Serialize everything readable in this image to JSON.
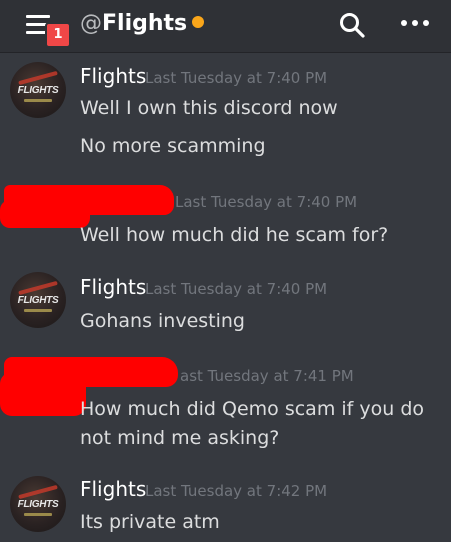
{
  "header": {
    "badge_count": "1",
    "at": "@",
    "channel_name": "Flights",
    "status_color": "#faa61a"
  },
  "messages": [
    {
      "username": "Flights",
      "timestamp": "Last Tuesday at 7:40 PM",
      "lines": [
        "Well I own this discord now",
        "No more scamming"
      ],
      "avatar_text": "FLIGHTS"
    },
    {
      "username": "",
      "timestamp": "Last Tuesday at 7:40 PM",
      "lines": [
        "Well how much did he scam for?"
      ],
      "redacted": true
    },
    {
      "username": "Flights",
      "timestamp": "Last Tuesday at 7:40 PM",
      "lines": [
        "Gohans investing"
      ],
      "avatar_text": "FLIGHTS"
    },
    {
      "username": "",
      "timestamp": "ast Tuesday at 7:41 PM",
      "lines": [
        "How much did Qemo scam if you do",
        "not mind me asking?"
      ],
      "redacted": true
    },
    {
      "username": "Flights",
      "timestamp": "Last Tuesday at 7:42 PM",
      "lines": [
        "Its private atm"
      ],
      "avatar_text": "FLIGHTS"
    }
  ]
}
